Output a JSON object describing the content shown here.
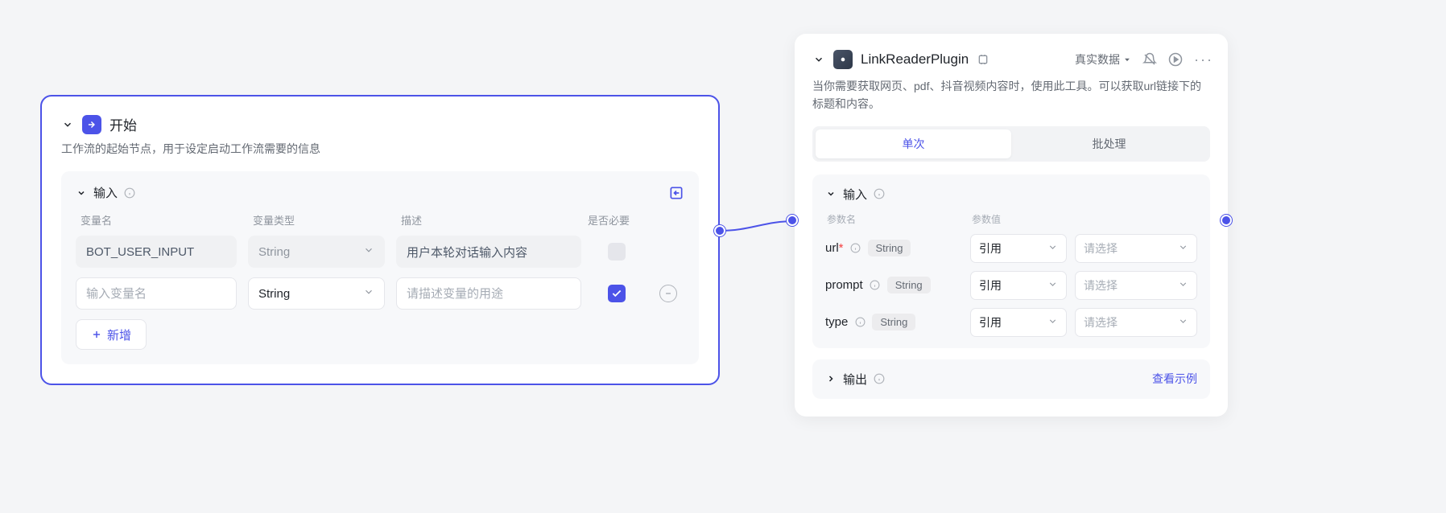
{
  "start_node": {
    "title": "开始",
    "description": "工作流的起始节点，用于设定启动工作流需要的信息",
    "input_section": {
      "title": "输入",
      "columns": {
        "name": "变量名",
        "type": "变量类型",
        "desc": "描述",
        "required": "是否必要"
      },
      "rows": [
        {
          "name": "BOT_USER_INPUT",
          "name_readonly": true,
          "type": "String",
          "type_readonly": true,
          "desc": "用户本轮对话输入内容",
          "desc_readonly": true,
          "required_checked": false,
          "required_disabled": true,
          "removable": false
        },
        {
          "name": "",
          "name_placeholder": "输入变量名",
          "name_readonly": false,
          "type": "String",
          "type_readonly": false,
          "desc": "",
          "desc_placeholder": "请描述变量的用途",
          "desc_readonly": false,
          "required_checked": true,
          "required_disabled": false,
          "removable": true
        }
      ],
      "add_button": "新增"
    }
  },
  "plugin_node": {
    "title": "LinkReaderPlugin",
    "data_mode": "真实数据",
    "description": "当你需要获取网页、pdf、抖音视频内容时，使用此工具。可以获取url链接下的标题和内容。",
    "tabs": {
      "single": "单次",
      "batch": "批处理",
      "active": "single"
    },
    "input_section": {
      "title": "输入",
      "columns": {
        "name": "参数名",
        "value": "参数值"
      },
      "ref_label": "引用",
      "select_placeholder": "请选择",
      "params": [
        {
          "name": "url",
          "required": true,
          "type": "String"
        },
        {
          "name": "prompt",
          "required": false,
          "type": "String"
        },
        {
          "name": "type",
          "required": false,
          "type": "String"
        }
      ]
    },
    "output_section": {
      "title": "输出",
      "view_example": "查看示例"
    }
  }
}
